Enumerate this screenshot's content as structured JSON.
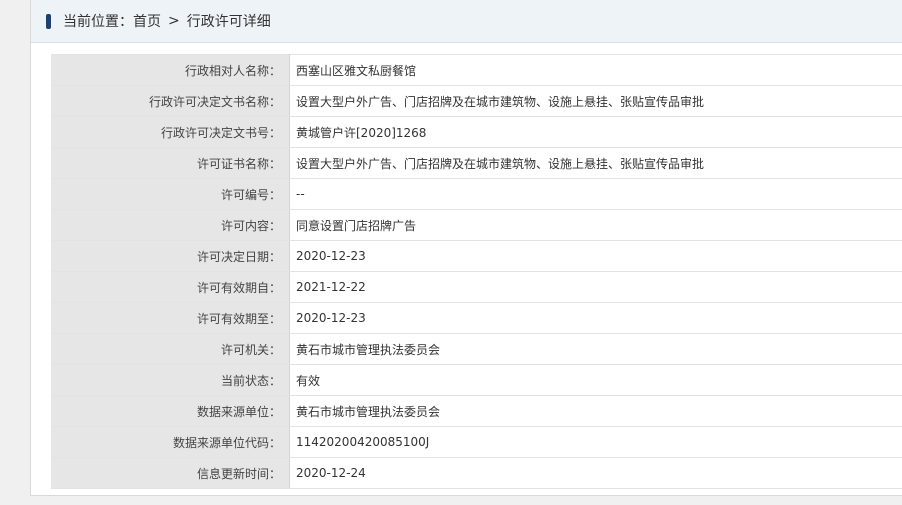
{
  "breadcrumb": {
    "prefix": "当前位置：",
    "home": "首页",
    "separator": ">",
    "current": "行政许可详细"
  },
  "rows": [
    {
      "label": "行政相对人名称：",
      "value": "西塞山区雅文私厨餐馆"
    },
    {
      "label": "行政许可决定文书名称：",
      "value": "设置大型户外广告、门店招牌及在城市建筑物、设施上悬挂、张贴宣传品审批"
    },
    {
      "label": "行政许可决定文书号：",
      "value": "黄城管户许[2020]1268"
    },
    {
      "label": "许可证书名称：",
      "value": "设置大型户外广告、门店招牌及在城市建筑物、设施上悬挂、张贴宣传品审批"
    },
    {
      "label": "许可编号：",
      "value": "--"
    },
    {
      "label": "许可内容：",
      "value": "同意设置门店招牌广告"
    },
    {
      "label": "许可决定日期：",
      "value": "2020-12-23"
    },
    {
      "label": "许可有效期自：",
      "value": "2021-12-22"
    },
    {
      "label": "许可有效期至：",
      "value": "2020-12-23"
    },
    {
      "label": "许可机关：",
      "value": "黄石市城市管理执法委员会"
    },
    {
      "label": "当前状态：",
      "value": "有效"
    },
    {
      "label": "数据来源单位：",
      "value": "黄石市城市管理执法委员会"
    },
    {
      "label": "数据来源单位代码：",
      "value": "11420200420085100J"
    },
    {
      "label": "信息更新时间：",
      "value": "2020-12-24"
    }
  ],
  "colors": {
    "marker": "#1f3f6e",
    "breadcrumb_bg": "#eef3f8",
    "label_bg": "#e6e6e6"
  }
}
